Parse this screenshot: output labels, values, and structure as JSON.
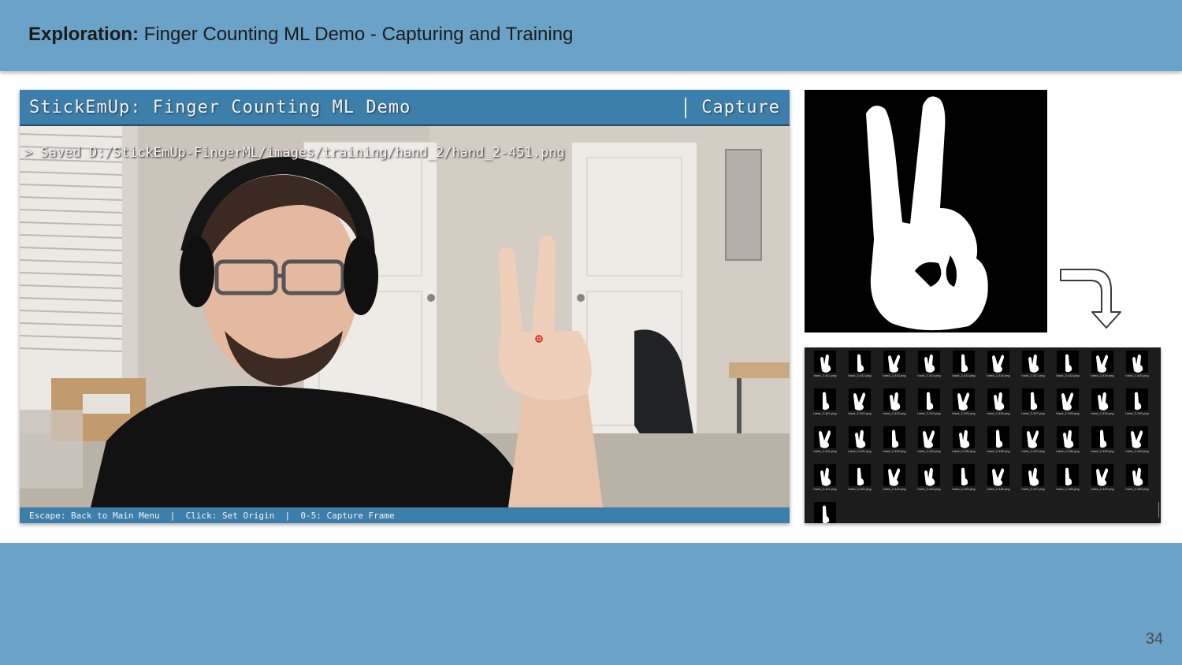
{
  "slide": {
    "title_bold": "Exploration:",
    "title_rest": " Finger Counting ML Demo - Capturing and Training",
    "page_number": "34"
  },
  "app": {
    "title": "StickEmUp: Finger Counting ML Demo",
    "mode": "Capture",
    "status": "> Saved D:/StickEmUp-FingerML/images/training/hand_2/hand_2-451.png",
    "footer": "Escape: Back to Main Menu  |  Click: Set Origin  |  0-5: Capture Frame"
  },
  "thumbnails": [
    {
      "label": "hand_2-411.png"
    },
    {
      "label": "hand_2-412.png"
    },
    {
      "label": "hand_2-413.png"
    },
    {
      "label": "hand_2-414.png"
    },
    {
      "label": "hand_2-415.png"
    },
    {
      "label": "hand_2-416.png"
    },
    {
      "label": "hand_2-417.png"
    },
    {
      "label": "hand_2-418.png"
    },
    {
      "label": "hand_2-419.png"
    },
    {
      "label": "hand_2-420.png"
    },
    {
      "label": "hand_2-421.png"
    },
    {
      "label": "hand_2-422.png"
    },
    {
      "label": "hand_2-423.png"
    },
    {
      "label": "hand_2-424.png"
    },
    {
      "label": "hand_2-425.png"
    },
    {
      "label": "hand_2-426.png"
    },
    {
      "label": "hand_2-427.png"
    },
    {
      "label": "hand_2-428.png"
    },
    {
      "label": "hand_2-429.png"
    },
    {
      "label": "hand_2-430.png"
    },
    {
      "label": "hand_2-431.png"
    },
    {
      "label": "hand_2-432.png"
    },
    {
      "label": "hand_2-433.png"
    },
    {
      "label": "hand_2-434.png"
    },
    {
      "label": "hand_2-435.png"
    },
    {
      "label": "hand_2-436.png"
    },
    {
      "label": "hand_2-437.png"
    },
    {
      "label": "hand_2-438.png"
    },
    {
      "label": "hand_2-439.png"
    },
    {
      "label": "hand_2-440.png"
    },
    {
      "label": "hand_2-441.png"
    },
    {
      "label": "hand_2-442.png"
    },
    {
      "label": "hand_2-443.png"
    },
    {
      "label": "hand_2-444.png"
    },
    {
      "label": "hand_2-445.png"
    },
    {
      "label": "hand_2-446.png"
    },
    {
      "label": "hand_2-447.png"
    },
    {
      "label": "hand_2-448.png"
    },
    {
      "label": "hand_2-449.png"
    },
    {
      "label": "hand_2-450.png"
    },
    {
      "label": "hand_2-451.png"
    }
  ],
  "colors": {
    "slide_bg": "#6aa2c8",
    "app_bar": "#3d7fab",
    "origin_marker": "#d8191e"
  }
}
